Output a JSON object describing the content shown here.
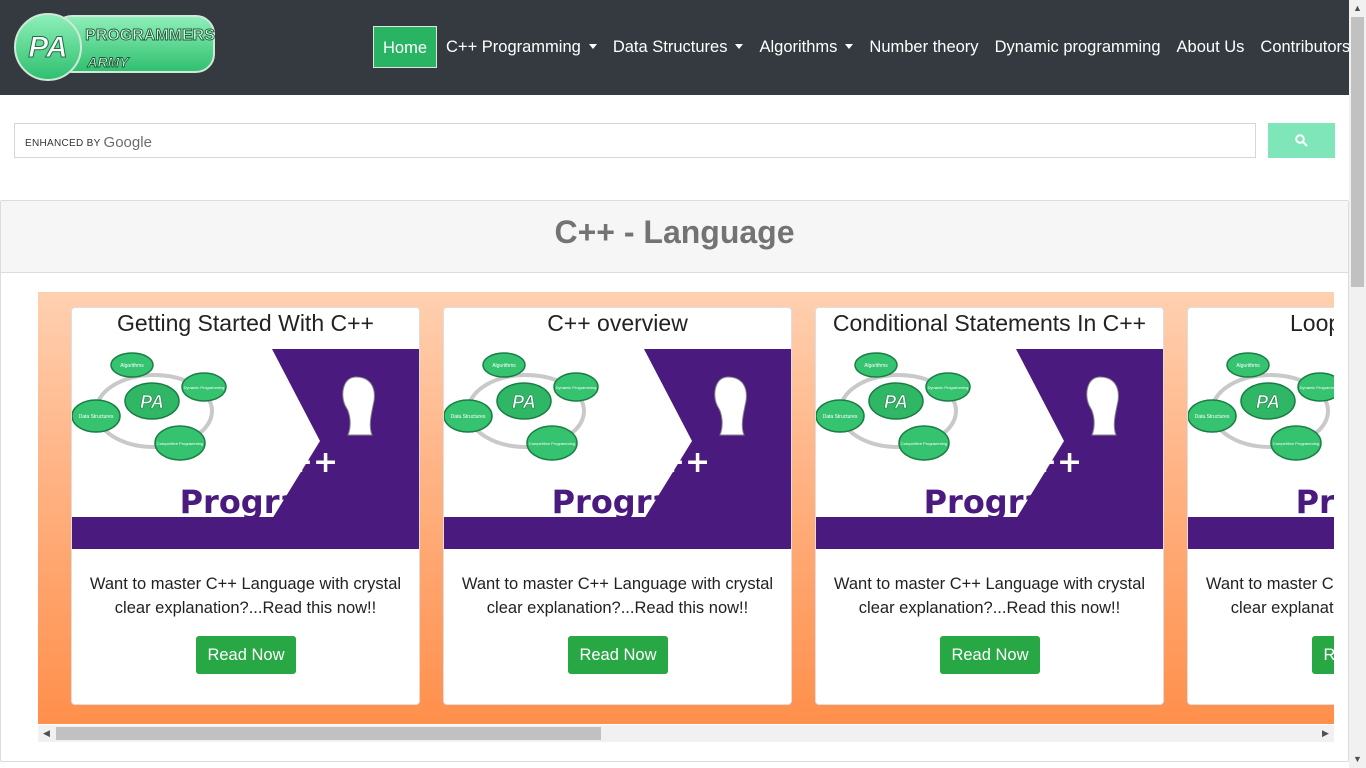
{
  "brand": {
    "logo_mark": "PA",
    "logo_line1": "PROGRAMMERS",
    "logo_line2": "ARMY",
    "accent": "#28b463"
  },
  "nav": {
    "items": [
      {
        "label": "Home",
        "active": true,
        "dropdown": false
      },
      {
        "label": "C++ Programming",
        "active": false,
        "dropdown": true
      },
      {
        "label": "Data Structures",
        "active": false,
        "dropdown": true
      },
      {
        "label": "Algorithms",
        "active": false,
        "dropdown": true
      },
      {
        "label": "Number theory",
        "active": false,
        "dropdown": false
      },
      {
        "label": "Dynamic programming",
        "active": false,
        "dropdown": false
      },
      {
        "label": "About Us",
        "active": false,
        "dropdown": false
      },
      {
        "label": "Contributors",
        "active": false,
        "dropdown": false
      }
    ]
  },
  "search": {
    "enhanced_by": "ENHANCED BY",
    "provider": "Google",
    "value": "",
    "button_icon": "search-icon",
    "button_color": "#7ee6b9"
  },
  "section": {
    "title": "C++ - Language",
    "cards": [
      {
        "title": "Getting Started With C++",
        "image_label_1": "C++",
        "image_label_2": "Programming",
        "description": "Want to master C++ Language with crystal clear explanation?...Read this now!!",
        "button": "Read Now"
      },
      {
        "title": "C++ overview",
        "image_label_1": "C++",
        "image_label_2": "Programming",
        "description": "Want to master C++ Language with crystal clear explanation?...Read this now!!",
        "button": "Read Now"
      },
      {
        "title": "Conditional Statements In C++",
        "image_label_1": "C++",
        "image_label_2": "Programming",
        "description": "Want to master C++ Language with crystal clear explanation?...Read this now!!",
        "button": "Read Now"
      },
      {
        "title": "Loops In C++",
        "image_label_1": "C++",
        "image_label_2": "Programming",
        "description": "Want to master C++ Language with crystal clear explanation?...Read this now!!",
        "button": "Read Now"
      }
    ],
    "image_bubbles": [
      "Algorithms",
      "Dynamic Programming",
      "Data Structures",
      "PA",
      "Competitive Programming"
    ]
  }
}
